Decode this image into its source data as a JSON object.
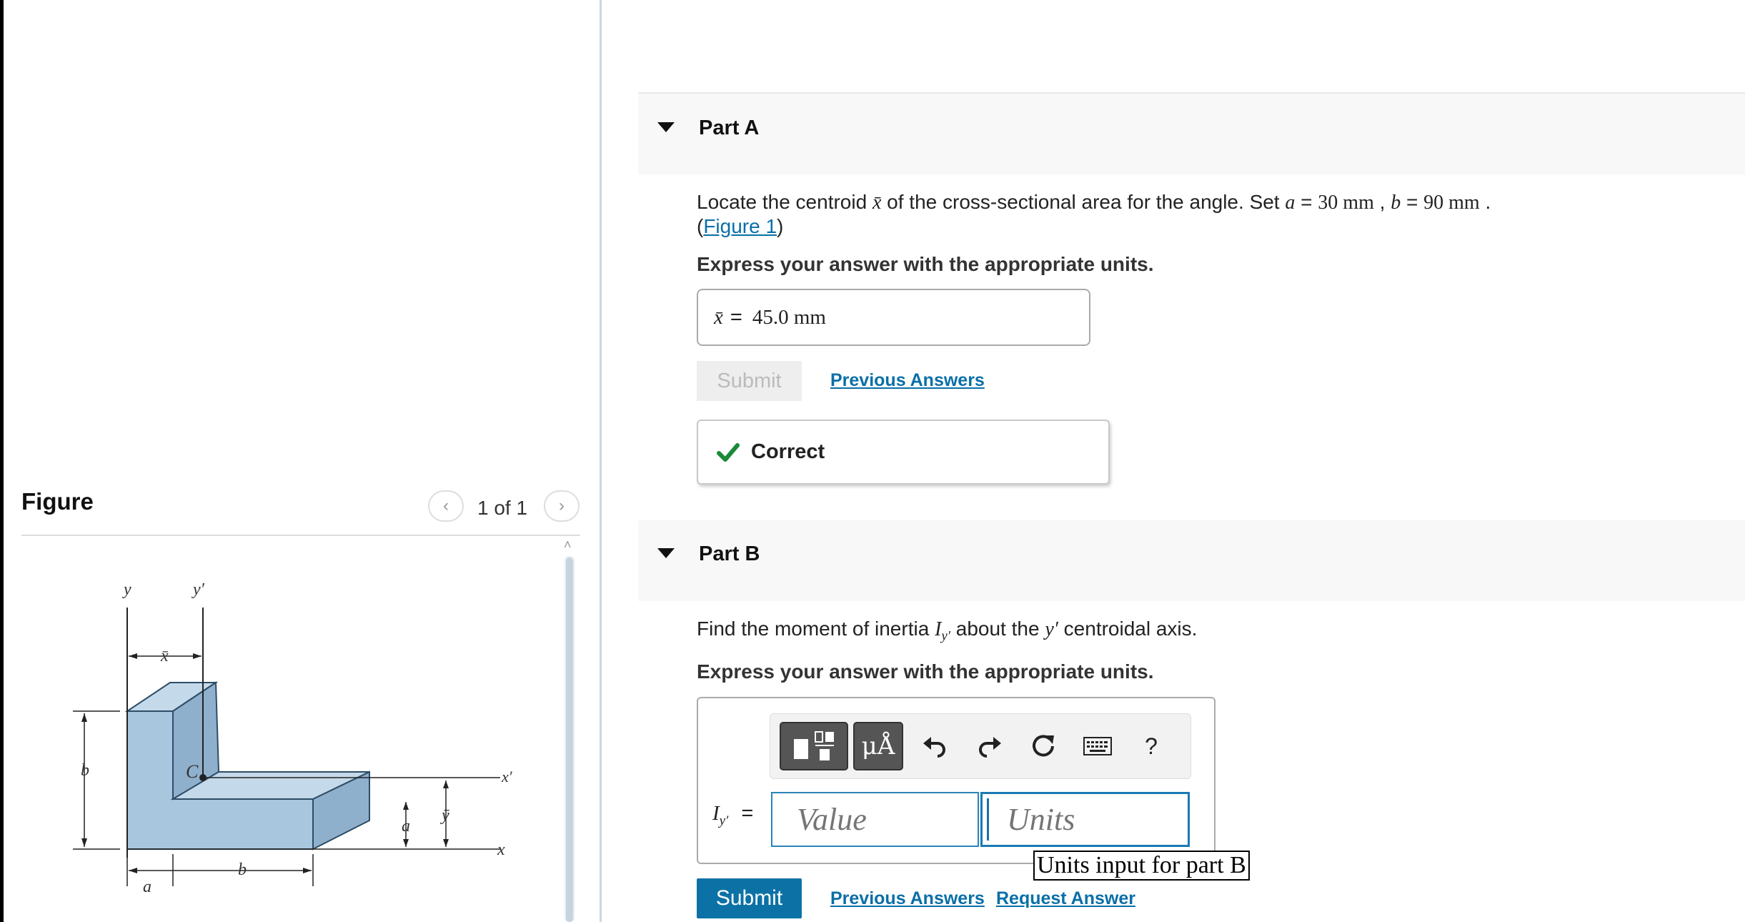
{
  "figure_panel": {
    "title": "Figure",
    "page_counter": "1 of 1",
    "prev_icon": "chevron-left-icon",
    "next_icon": "chevron-right-icon",
    "diagram_labels": {
      "y": "y",
      "y_prime": "y′",
      "x_bar": "x̄",
      "c": "C",
      "b_left": "b",
      "x_prime": "x′",
      "a_vertical": "a",
      "y_bar": "ȳ",
      "x": "x",
      "a_bottom": "a",
      "b_bottom": "b"
    }
  },
  "part_a": {
    "title": "Part A",
    "question_prefix": "Locate the centroid",
    "question_symbol": "x̄",
    "question_mid": "of the cross-sectional area for the angle. Set",
    "param_a_sym": "a",
    "param_a_val": "30 mm",
    "param_b_sym": "b",
    "param_b_val": "90 mm",
    "figure_link_open": "(",
    "figure_link": "Figure 1",
    "figure_link_close": ")",
    "express": "Express your answer with the appropriate units.",
    "answer_symbol": "x̄",
    "answer_equals": "=",
    "answer_value": "45.0 mm",
    "submit_label": "Submit",
    "previous_answers_label": "Previous Answers",
    "feedback_label": "Correct",
    "feedback_icon": "checkmark-icon"
  },
  "part_b": {
    "title": "Part B",
    "question_prefix": "Find the moment of inertia",
    "question_symbol": "I",
    "question_sub": "y′",
    "question_mid": "about the",
    "question_axis": "y′",
    "question_suffix": "centroidal axis.",
    "express": "Express your answer with the appropriate units.",
    "toolbar": {
      "templates_icon": "templates-icon",
      "units_label": "μÅ",
      "undo_icon": "undo-icon",
      "redo_icon": "redo-icon",
      "reset_icon": "reset-icon",
      "keyboard_icon": "keyboard-icon",
      "help_label": "?"
    },
    "answer_symbol": "I",
    "answer_sub": "y′",
    "answer_equals": "=",
    "value_placeholder": "Value",
    "units_placeholder": "Units",
    "units_tooltip": "Units input for part B",
    "submit_label": "Submit",
    "previous_answers_label": "Previous Answers",
    "request_answer_label": "Request Answer"
  },
  "colors": {
    "link": "#0a6fa8",
    "submit_active": "#0c72a6",
    "correct_check": "#1b8a3a",
    "shape_fill": "#a9c6df"
  }
}
